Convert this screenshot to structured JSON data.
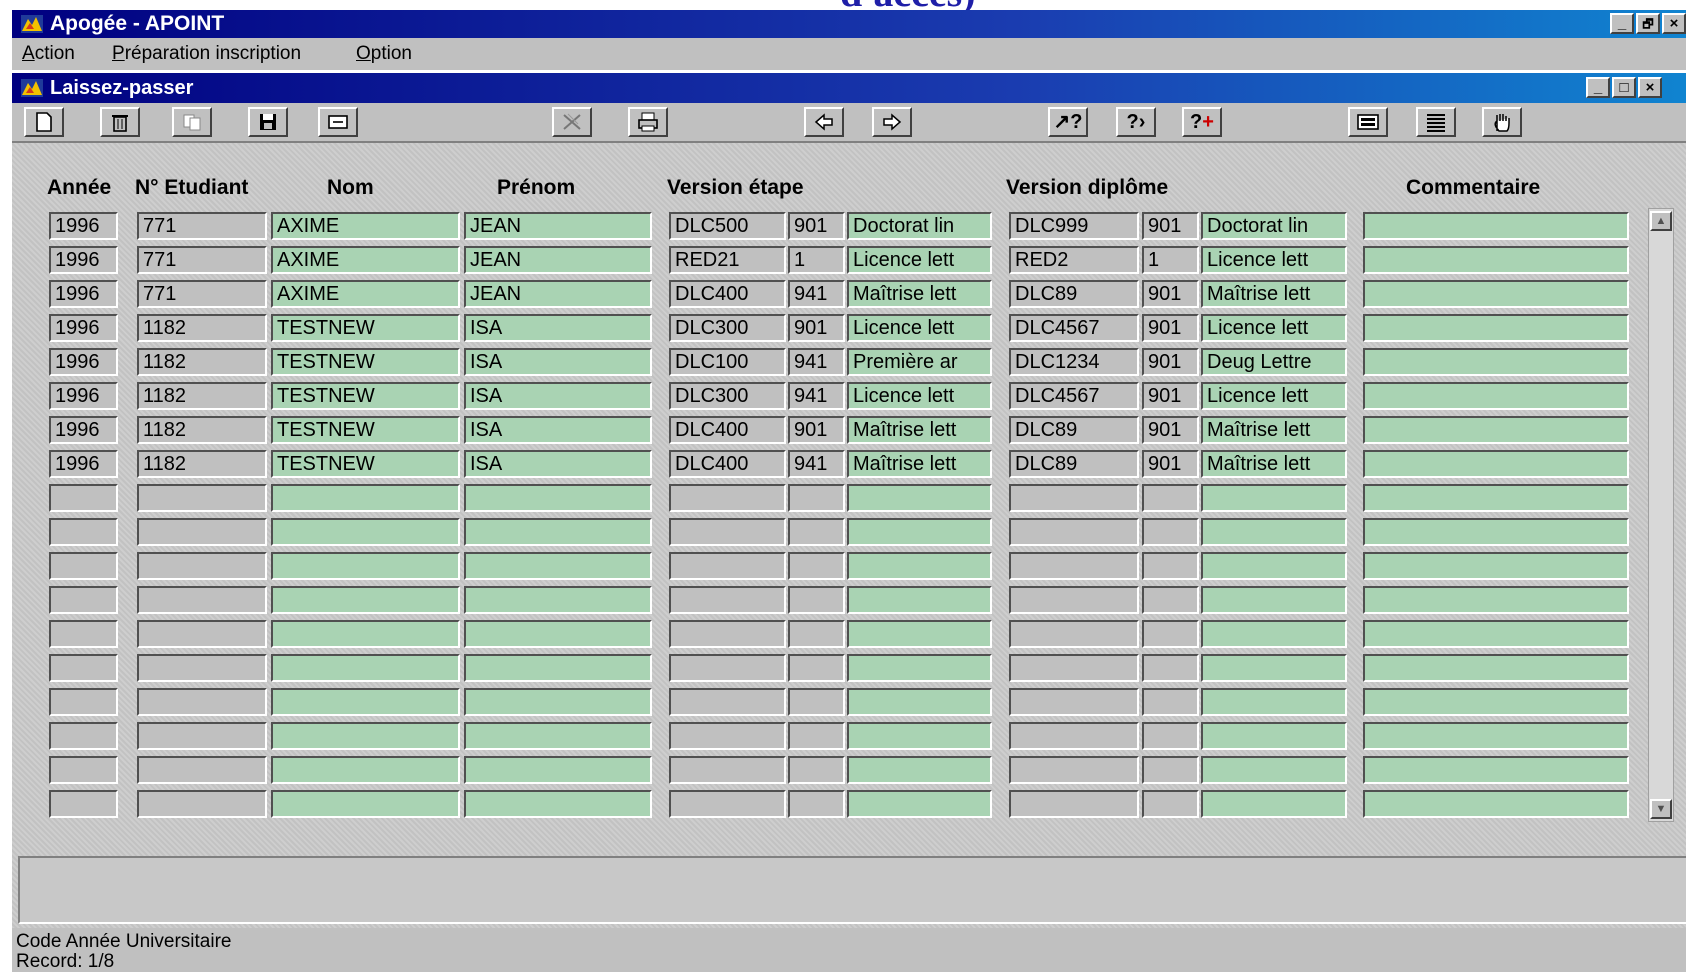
{
  "slide_caption_fragment": "d'accès)",
  "app_window": {
    "title": "Apogée - APOINT",
    "controls": {
      "minimize": "_",
      "restore": "🗗",
      "close": "×"
    }
  },
  "menu": {
    "items": [
      {
        "label": "Action",
        "accel": "A"
      },
      {
        "label": "Préparation inscription",
        "accel": "P"
      },
      {
        "label": "Option",
        "accel": "O"
      }
    ]
  },
  "form_window": {
    "title": "Laissez-passer",
    "controls": {
      "minimize": "_",
      "maximize": "□",
      "close": "×"
    }
  },
  "toolbar": {
    "buttons": [
      {
        "name": "new-record-icon"
      },
      {
        "name": "delete-icon"
      },
      {
        "name": "copy-icon"
      },
      {
        "name": "save-icon"
      },
      {
        "name": "clear-icon"
      },
      {
        "name": "cut-icon"
      },
      {
        "name": "print-icon"
      },
      {
        "name": "previous-icon"
      },
      {
        "name": "next-icon"
      },
      {
        "name": "help-icon"
      },
      {
        "name": "help-next-icon"
      },
      {
        "name": "help-add-icon"
      },
      {
        "name": "keyboard-icon"
      },
      {
        "name": "list-icon"
      },
      {
        "name": "hand-icon"
      }
    ]
  },
  "columns": {
    "annee": "Année",
    "num_etudiant": "N° Etudiant",
    "nom": "Nom",
    "prenom": "Prénom",
    "version_etape": "Version étape",
    "version_diplome": "Version diplôme",
    "commentaire": "Commentaire"
  },
  "rows": [
    [
      "1996",
      "771",
      "AXIME",
      "JEAN",
      "DLC500",
      "901",
      "Doctorat lin",
      "DLC999",
      "901",
      "Doctorat lin",
      ""
    ],
    [
      "1996",
      "771",
      "AXIME",
      "JEAN",
      "RED21",
      "1",
      "Licence lett",
      "RED2",
      "1",
      "Licence lett",
      ""
    ],
    [
      "1996",
      "771",
      "AXIME",
      "JEAN",
      "DLC400",
      "941",
      "Maîtrise lett",
      "DLC89",
      "901",
      "Maîtrise lett",
      ""
    ],
    [
      "1996",
      "1182",
      "TESTNEW",
      "ISA",
      "DLC300",
      "901",
      "Licence lett",
      "DLC4567",
      "901",
      "Licence lett",
      ""
    ],
    [
      "1996",
      "1182",
      "TESTNEW",
      "ISA",
      "DLC100",
      "941",
      "Première ar",
      "DLC1234",
      "901",
      "Deug Lettre",
      ""
    ],
    [
      "1996",
      "1182",
      "TESTNEW",
      "ISA",
      "DLC300",
      "941",
      "Licence lett",
      "DLC4567",
      "901",
      "Licence lett",
      ""
    ],
    [
      "1996",
      "1182",
      "TESTNEW",
      "ISA",
      "DLC400",
      "901",
      "Maîtrise lett",
      "DLC89",
      "901",
      "Maîtrise lett",
      ""
    ],
    [
      "1996",
      "1182",
      "TESTNEW",
      "ISA",
      "DLC400",
      "941",
      "Maîtrise lett",
      "DLC89",
      "901",
      "Maîtrise lett",
      ""
    ],
    [
      "",
      "",
      "",
      "",
      "",
      "",
      "",
      "",
      "",
      "",
      ""
    ],
    [
      "",
      "",
      "",
      "",
      "",
      "",
      "",
      "",
      "",
      "",
      ""
    ],
    [
      "",
      "",
      "",
      "",
      "",
      "",
      "",
      "",
      "",
      "",
      ""
    ],
    [
      "",
      "",
      "",
      "",
      "",
      "",
      "",
      "",
      "",
      "",
      ""
    ],
    [
      "",
      "",
      "",
      "",
      "",
      "",
      "",
      "",
      "",
      "",
      ""
    ],
    [
      "",
      "",
      "",
      "",
      "",
      "",
      "",
      "",
      "",
      "",
      ""
    ],
    [
      "",
      "",
      "",
      "",
      "",
      "",
      "",
      "",
      "",
      "",
      ""
    ],
    [
      "",
      "",
      "",
      "",
      "",
      "",
      "",
      "",
      "",
      "",
      ""
    ],
    [
      "",
      "",
      "",
      "",
      "",
      "",
      "",
      "",
      "",
      "",
      ""
    ],
    [
      "",
      "",
      "",
      "",
      "",
      "",
      "",
      "",
      "",
      "",
      ""
    ]
  ],
  "status": {
    "hint": "Code Année Universitaire",
    "record": "Record: 1/8"
  }
}
